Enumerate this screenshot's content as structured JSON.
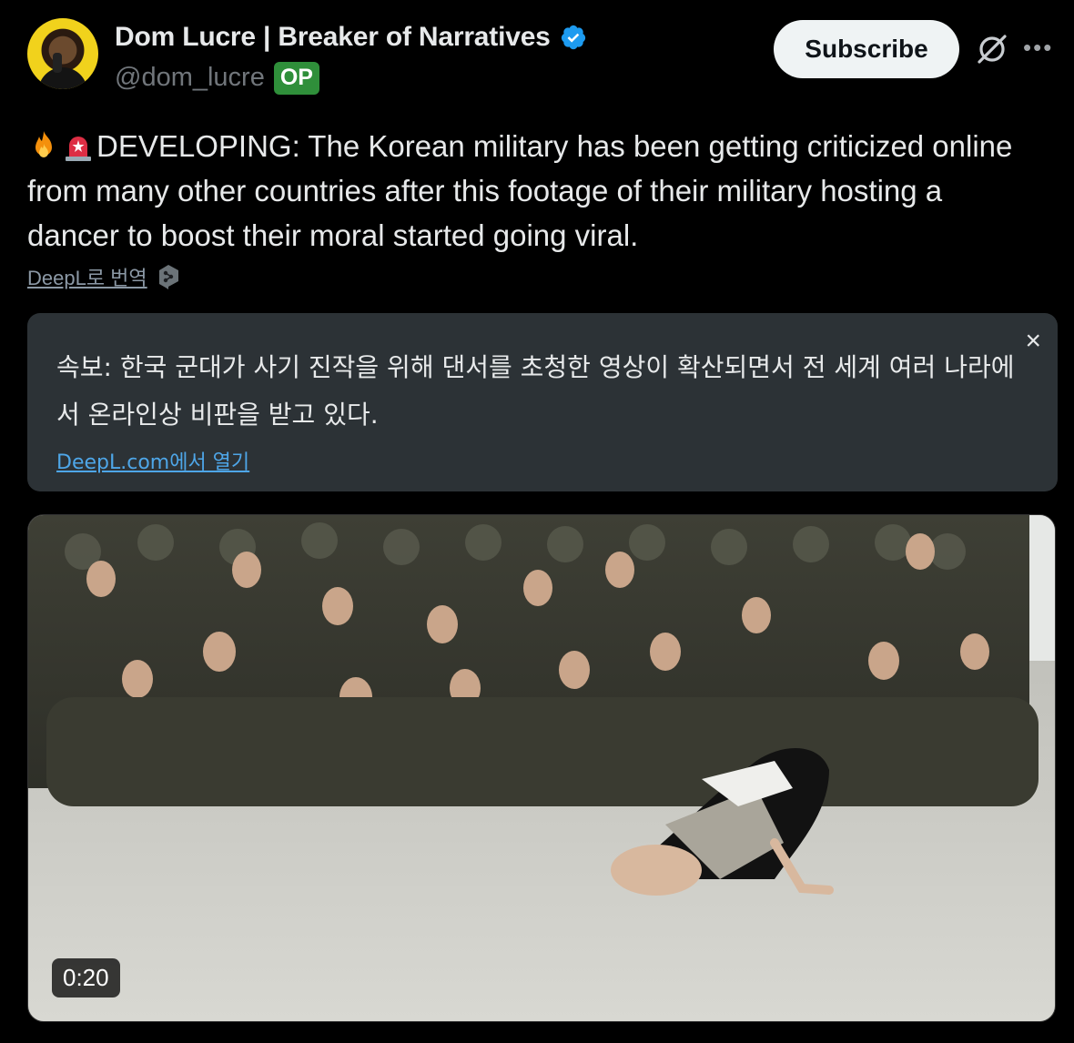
{
  "author": {
    "display_name": "Dom Lucre | Breaker of Narratives",
    "handle": "@dom_lucre",
    "badge": "OP",
    "verified": true
  },
  "actions": {
    "subscribe_label": "Subscribe",
    "grok_icon": "grok-icon",
    "more_icon": "more-icon"
  },
  "tweet": {
    "text": "DEVELOPING: The Korean military has been getting criticized online from many other countries after this footage of their military hosting a dancer to boost their moral started going viral.",
    "emoji": [
      "fire-emoji",
      "siren-emoji"
    ]
  },
  "translate": {
    "link_label": "DeepL로 번역"
  },
  "deepl_panel": {
    "translation": "속보: 한국 군대가 사기 진작을 위해 댄서를 초청한 영상이 확산되면서 전 세계 여러 나라에서 온라인상 비판을 받고 있다.",
    "close_label": "×",
    "open_link": "DeepL.com에서 열기"
  },
  "media": {
    "duration": "0:20"
  },
  "colors": {
    "background": "#000000",
    "text": "#e7e9ea",
    "muted": "#71767b",
    "verified": "#1d9bf0",
    "op_badge": "#2f8f3a",
    "deepl_panel": "#2c3236",
    "link": "#4ea6e8"
  }
}
